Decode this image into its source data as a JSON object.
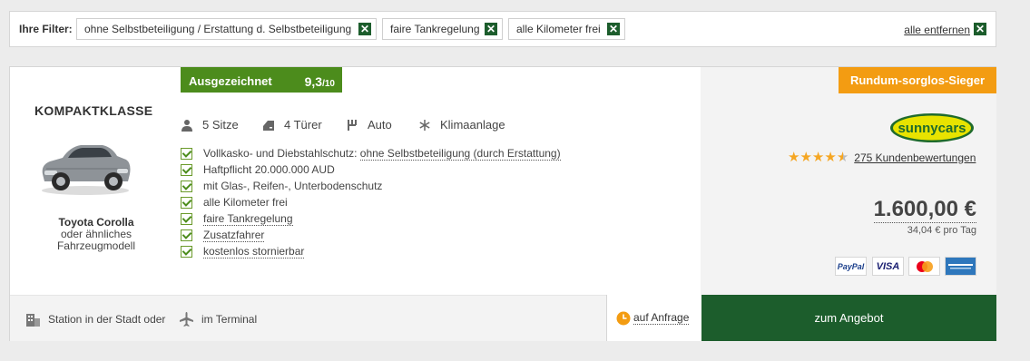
{
  "filters": {
    "label": "Ihre Filter:",
    "chips": [
      "ohne Selbstbeteiligung / Erstattung d. Selbstbeteiligung",
      "faire Tankregelung",
      "alle Kilometer frei"
    ],
    "remove_all": "alle entfernen",
    "close_glyph": "✕"
  },
  "offer": {
    "rating": {
      "label": "Ausgezeichnet",
      "score": "9,3",
      "max": "/10"
    },
    "car_class": "KOMPAKTKLASSE",
    "car": {
      "name": "Toyota Corolla",
      "similar": "oder ähnliches Fahrzeugmodell"
    },
    "specs": [
      "5 Sitze",
      "4 Türer",
      "Auto",
      "Klimaanlage"
    ],
    "spec_icons": [
      "person-icon",
      "door-icon",
      "gearshift-icon",
      "snowflake-icon"
    ],
    "features": {
      "f1_prefix": "Vollkasko- und Diebstahlschutz:",
      "f1_link": "ohne Selbstbeteiligung (durch Erstattung)",
      "f2": "Haftpflicht 20.000.000 AUD",
      "f3": "mit Glas-, Reifen-, Unterbodenschutz",
      "f4": "alle Kilometer frei",
      "f5": "faire Tankregelung",
      "f6": "Zusatzfahrer",
      "f7": "kostenlos stornierbar"
    },
    "badge": "Rundum-sorglos-Sieger",
    "provider_logo": "sunnycars",
    "stars_value": 4.5,
    "reviews": "275 Kundenbewertungen",
    "price": "1.600,00 €",
    "per_day": "34,04 € pro Tag",
    "payments": [
      "PayPal",
      "VISA",
      "mastercard",
      "american express"
    ],
    "locations": [
      "Station in der Stadt oder",
      "im Terminal"
    ],
    "availability": "auf Anfrage",
    "cta": "zum Angebot"
  },
  "colors": {
    "dark_green": "#1c5d2c",
    "rating_green": "#4c8c1c",
    "badge_orange": "#f39c12",
    "star": "#f5a623"
  }
}
